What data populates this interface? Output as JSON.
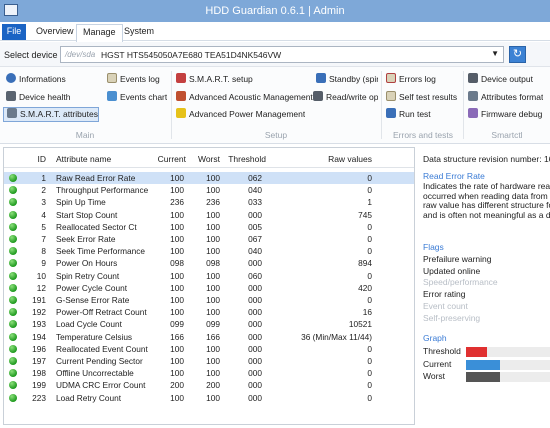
{
  "window": {
    "title": "HDD Guardian 0.6.1 | Admin"
  },
  "menu": {
    "file": "File",
    "overview": "Overview",
    "manage": "Manage",
    "system": "System"
  },
  "device": {
    "label": "Select device",
    "path": "/dev/sda",
    "model": "HGST HTS545050A7E680   TEA51D4NK546VW"
  },
  "ribbon": {
    "main": {
      "items": [
        "Informations",
        "Device health",
        "S.M.A.R.T. attributes",
        "Events log",
        "Events chart"
      ],
      "label": "Main"
    },
    "setup": {
      "items": [
        "S.M.A.R.T. setup",
        "Advanced Acoustic Management",
        "Advanced Power Management",
        "Standby (spin",
        "Read/write op"
      ],
      "label": "Setup"
    },
    "errors": {
      "items": [
        "Errors log",
        "Self test results",
        "Run test"
      ],
      "label": "Errors and tests"
    },
    "smartctl": {
      "items": [
        "Device output",
        "Attributes format",
        "Firmware debug"
      ],
      "label": "Smartctl"
    }
  },
  "table": {
    "headers": {
      "id": "ID",
      "attribute": "Attribute name",
      "current": "Current",
      "worst": "Worst",
      "threshold": "Threshold",
      "raw": "Raw values"
    },
    "rows": [
      {
        "id": "1",
        "name": "Raw Read Error Rate",
        "cur": "100",
        "worst": "100",
        "thr": "062",
        "raw": "0"
      },
      {
        "id": "2",
        "name": "Throughput Performance",
        "cur": "100",
        "worst": "100",
        "thr": "040",
        "raw": "0"
      },
      {
        "id": "3",
        "name": "Spin Up Time",
        "cur": "236",
        "worst": "236",
        "thr": "033",
        "raw": "1"
      },
      {
        "id": "4",
        "name": "Start Stop Count",
        "cur": "100",
        "worst": "100",
        "thr": "000",
        "raw": "745"
      },
      {
        "id": "5",
        "name": "Reallocated Sector Ct",
        "cur": "100",
        "worst": "100",
        "thr": "005",
        "raw": "0"
      },
      {
        "id": "7",
        "name": "Seek Error Rate",
        "cur": "100",
        "worst": "100",
        "thr": "067",
        "raw": "0"
      },
      {
        "id": "8",
        "name": "Seek Time Performance",
        "cur": "100",
        "worst": "100",
        "thr": "040",
        "raw": "0"
      },
      {
        "id": "9",
        "name": "Power On Hours",
        "cur": "098",
        "worst": "098",
        "thr": "000",
        "raw": "894"
      },
      {
        "id": "10",
        "name": "Spin Retry Count",
        "cur": "100",
        "worst": "100",
        "thr": "060",
        "raw": "0"
      },
      {
        "id": "12",
        "name": "Power Cycle Count",
        "cur": "100",
        "worst": "100",
        "thr": "000",
        "raw": "420"
      },
      {
        "id": "191",
        "name": "G-Sense Error Rate",
        "cur": "100",
        "worst": "100",
        "thr": "000",
        "raw": "0"
      },
      {
        "id": "192",
        "name": "Power-Off Retract Count",
        "cur": "100",
        "worst": "100",
        "thr": "000",
        "raw": "16"
      },
      {
        "id": "193",
        "name": "Load Cycle Count",
        "cur": "099",
        "worst": "099",
        "thr": "000",
        "raw": "10521"
      },
      {
        "id": "194",
        "name": "Temperature Celsius",
        "cur": "166",
        "worst": "166",
        "thr": "000",
        "raw": "36 (Min/Max 11/44)"
      },
      {
        "id": "196",
        "name": "Reallocated Event Count",
        "cur": "100",
        "worst": "100",
        "thr": "000",
        "raw": "0"
      },
      {
        "id": "197",
        "name": "Current Pending Sector",
        "cur": "100",
        "worst": "100",
        "thr": "000",
        "raw": "0"
      },
      {
        "id": "198",
        "name": "Offline Uncorrectable",
        "cur": "100",
        "worst": "100",
        "thr": "000",
        "raw": "0"
      },
      {
        "id": "199",
        "name": "UDMA CRC Error Count",
        "cur": "200",
        "worst": "200",
        "thr": "000",
        "raw": "0"
      },
      {
        "id": "223",
        "name": "Load Retry Count",
        "cur": "100",
        "worst": "100",
        "thr": "000",
        "raw": "0"
      }
    ]
  },
  "side": {
    "revision": "Data structure revision number: 16",
    "attr_title": "Read Error Rate",
    "description": "Indicates the rate of hardware read errors that occurred when reading data from a disk surface. The raw value has different structure for different vendors and is often not meaningful as a decimal number.",
    "flags_title": "Flags",
    "flags": [
      {
        "text": "Prefailure warning",
        "active": true
      },
      {
        "text": "Updated online",
        "active": true
      },
      {
        "text": "Speed/performance",
        "active": false
      },
      {
        "text": "Error rating",
        "active": true
      },
      {
        "text": "Event count",
        "active": false
      },
      {
        "text": "Self-preserving",
        "active": false
      }
    ],
    "graph_title": "Graph",
    "graph": [
      {
        "label": "Threshold",
        "value": 62,
        "color": "#e03030"
      },
      {
        "label": "Current",
        "value": 100,
        "color": "#3a8fd8"
      },
      {
        "label": "Worst",
        "value": 100,
        "color": "#555555"
      }
    ]
  },
  "colors": {
    "titlebar": "#7ea8d8",
    "accent": "#1b64c4",
    "ok": "#1f9a1f",
    "selected_row": "#cfe1f7"
  }
}
